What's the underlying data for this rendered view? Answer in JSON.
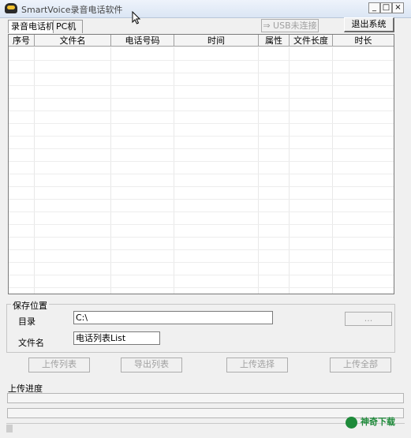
{
  "window": {
    "title": "SmartVoice录音电话软件",
    "controls": {
      "minimize": "_",
      "maximize": "□",
      "close": "×"
    }
  },
  "tabs": [
    {
      "label": "录音电话机",
      "active": true
    },
    {
      "label": "PC机",
      "active": false
    }
  ],
  "toolbar": {
    "usb_status": "⇒ USB未连接",
    "exit_label": "退出系统"
  },
  "list": {
    "columns": [
      "序号",
      "文件名",
      "电话号码",
      "时间",
      "属性",
      "文件长度",
      "时长"
    ],
    "rows": []
  },
  "save": {
    "group_title": "保存位置",
    "dir_label": "目录",
    "dir_value": "C:\\",
    "browse_label": "...",
    "filename_label": "文件名",
    "filename_value": "电话列表List"
  },
  "actions": {
    "upload_list": "上传列表",
    "export_list": "导出列表",
    "upload_selected": "上传选择",
    "upload_all": "上传全部"
  },
  "progress": {
    "label": "上传进度",
    "bar1_fraction": 0,
    "bar2_fraction": 0
  },
  "watermark": {
    "text": "神奇下载"
  },
  "colors": {
    "titlebar": "#dbe6f4",
    "disabled_text": "#a0a0a0"
  }
}
